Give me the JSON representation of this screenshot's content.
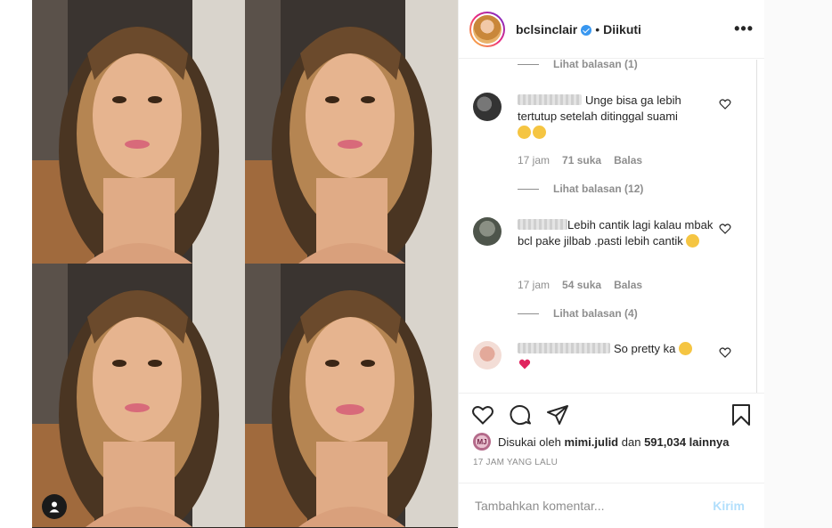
{
  "header": {
    "username": "bclsinclair",
    "separator": "•",
    "follow_status": "Diikuti",
    "more_label": "•••"
  },
  "comments": {
    "top_view_replies": "Lihat balasan (1)",
    "items": [
      {
        "text": "Unge bisa ga lebih tertutup setelah ditinggal suami",
        "time": "17 jam",
        "likes": "71 suka",
        "reply": "Balas",
        "view_replies": "Lihat balasan (12)",
        "emoji": [
          "loudly-crying-face",
          "loudly-crying-face"
        ]
      },
      {
        "text": "Lebih cantik lagi kalau mbak bcl pake jilbab .pasti lebih cantik",
        "time": "17 jam",
        "likes": "54 suka",
        "reply": "Balas",
        "view_replies": "Lihat balasan (4)",
        "emoji": [
          "grinning-face"
        ]
      },
      {
        "text": "So pretty ka",
        "emoji": [
          "heart-eyes-face",
          "red-heart"
        ]
      }
    ]
  },
  "likes": {
    "avatar_initials": "MJ",
    "prefix": "Disukai oleh",
    "user": "mimi.julid",
    "connector": "dan",
    "count": "591,034 lainnya"
  },
  "timestamp": "17 JAM YANG LALU",
  "add_comment": {
    "placeholder": "Tambahkan komentar...",
    "post_label": "Kirim"
  },
  "colors": {
    "verified": "#3897f0",
    "post_disabled": "#b2dffc",
    "muted": "#8e8e8e"
  }
}
